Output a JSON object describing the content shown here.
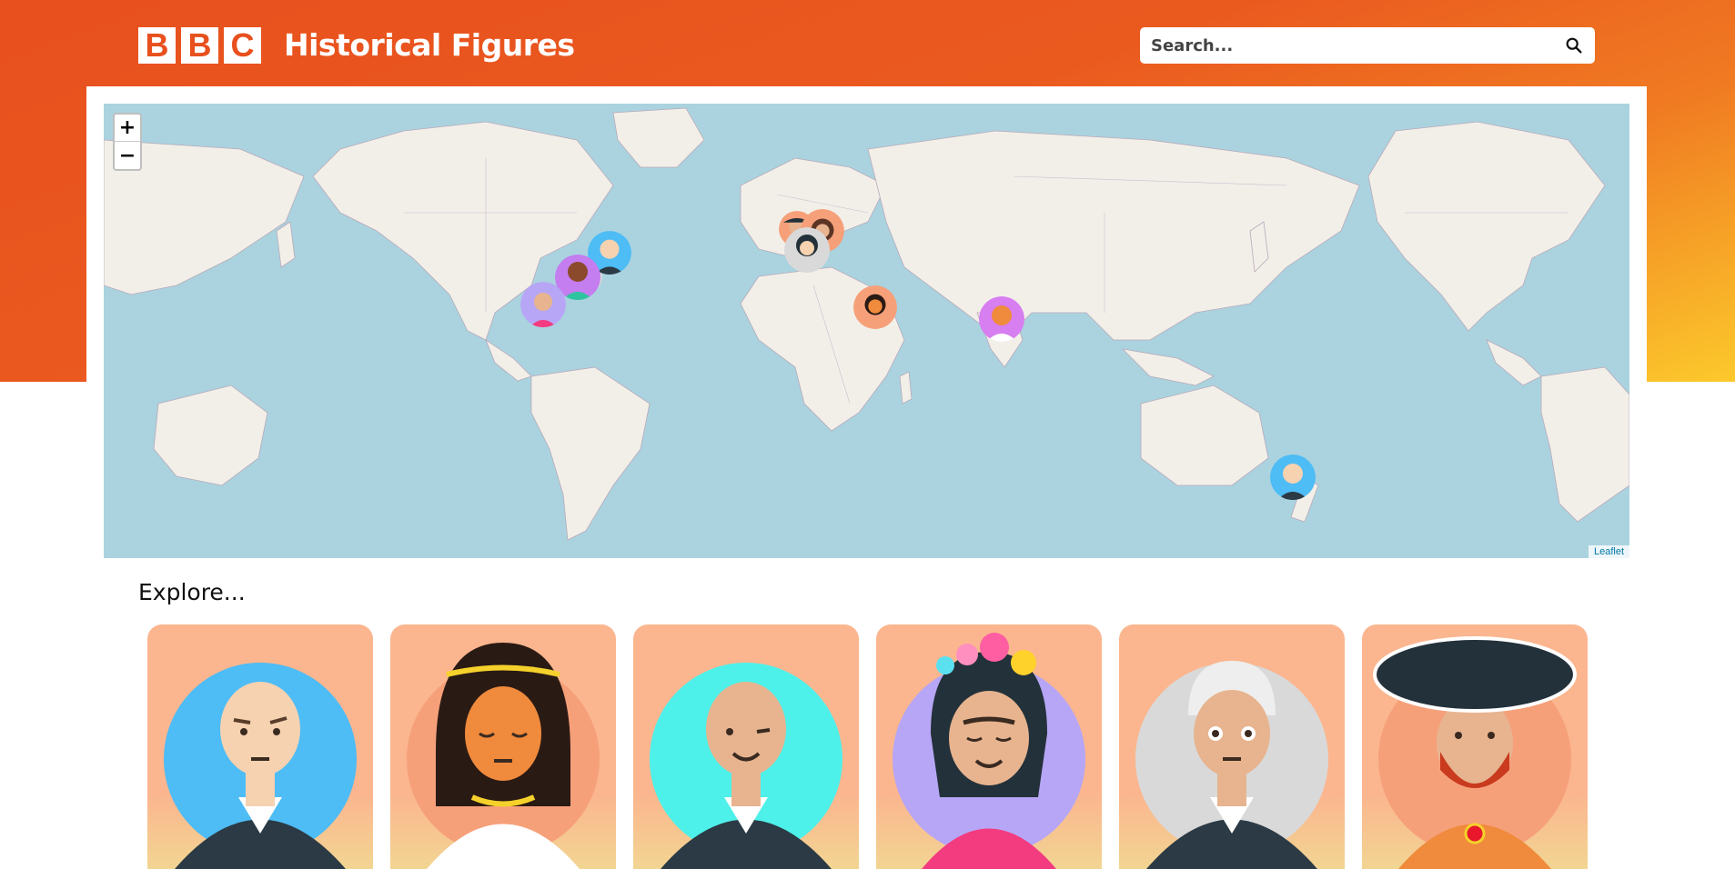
{
  "header": {
    "logo_letters": [
      "B",
      "B",
      "C"
    ],
    "title": "Historical Figures",
    "search_placeholder": "Search...",
    "search_icon": "search-icon"
  },
  "map": {
    "zoom_in_label": "+",
    "zoom_out_label": "−",
    "attribution": "Leaflet"
  },
  "explore": {
    "heading": "Explore..."
  },
  "colors": {
    "brand_orange": "#e8501e",
    "gradient_end": "#fcc92c",
    "map_water": "#aad3df",
    "map_land": "#f2efe9",
    "card_bg": "#fbb68f"
  }
}
